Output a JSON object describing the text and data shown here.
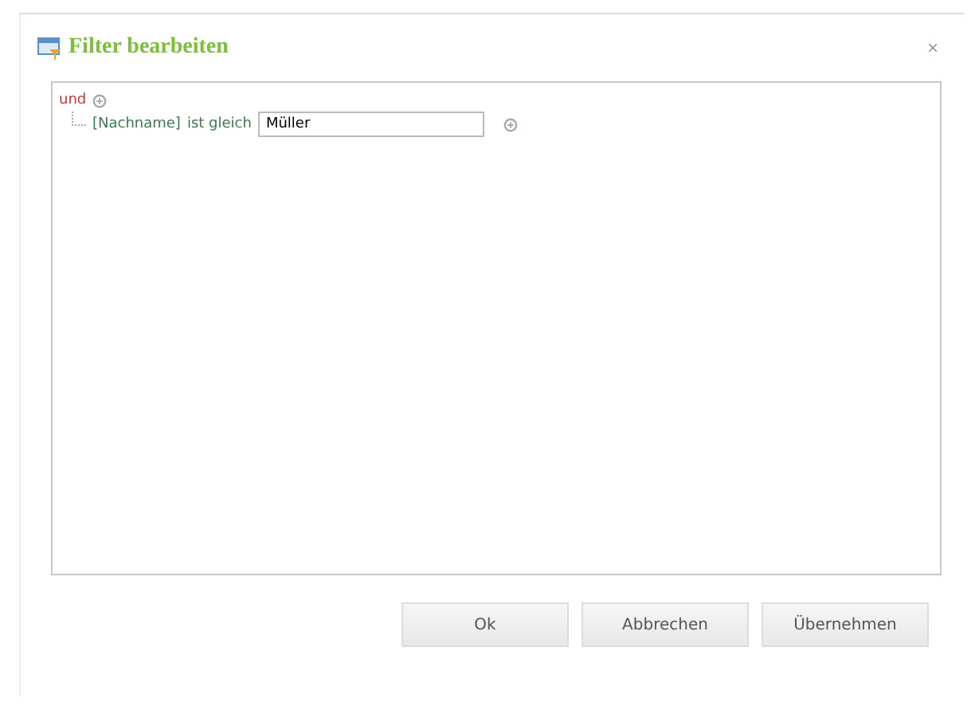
{
  "window": {
    "title": "Filter bearbeiten",
    "close": "×"
  },
  "filter": {
    "operator": "und",
    "conditions": [
      {
        "field": "[Nachname]",
        "comparison": "ist gleich",
        "value": "Müller"
      }
    ]
  },
  "buttons": [
    "Ok",
    "Abbrechen",
    "Übernehmen"
  ]
}
